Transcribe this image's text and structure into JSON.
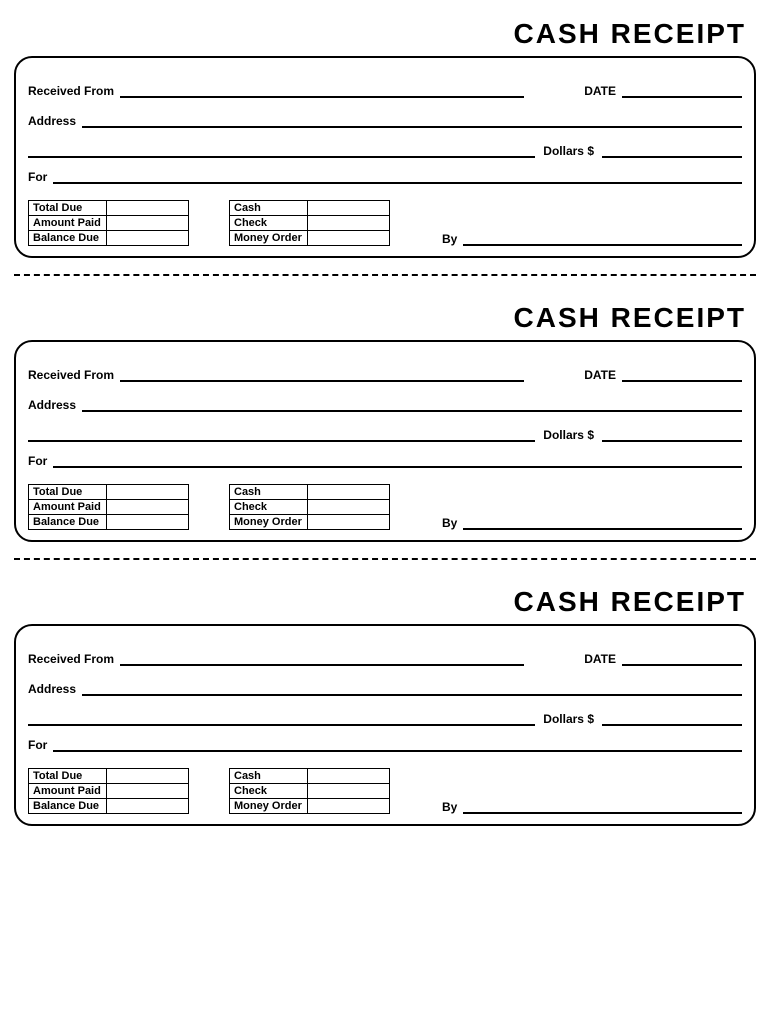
{
  "receipts": [
    {
      "title": "CASH RECEIPT",
      "labels": {
        "received_from": "Received From",
        "date": "DATE",
        "address": "Address",
        "dollars": "Dollars $",
        "for": "For",
        "by": "By"
      },
      "summary_rows": [
        "Total Due",
        "Amount Paid",
        "Balance Due"
      ],
      "method_rows": [
        "Cash",
        "Check",
        "Money Order"
      ]
    },
    {
      "title": "CASH RECEIPT",
      "labels": {
        "received_from": "Received From",
        "date": "DATE",
        "address": "Address",
        "dollars": "Dollars $",
        "for": "For",
        "by": "By"
      },
      "summary_rows": [
        "Total Due",
        "Amount Paid",
        "Balance Due"
      ],
      "method_rows": [
        "Cash",
        "Check",
        "Money Order"
      ]
    },
    {
      "title": "CASH RECEIPT",
      "labels": {
        "received_from": "Received From",
        "date": "DATE",
        "address": "Address",
        "dollars": "Dollars $",
        "for": "For",
        "by": "By"
      },
      "summary_rows": [
        "Total Due",
        "Amount Paid",
        "Balance Due"
      ],
      "method_rows": [
        "Cash",
        "Check",
        "Money Order"
      ]
    }
  ]
}
